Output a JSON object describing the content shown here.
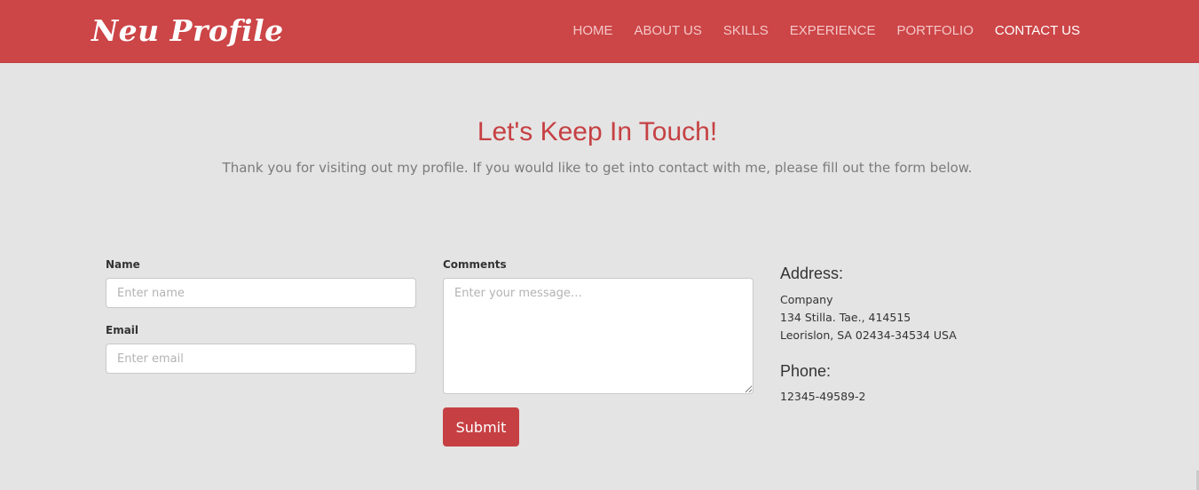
{
  "header": {
    "brand": "Neu Profile",
    "nav": [
      "HOME",
      "ABOUT US",
      "SKILLS",
      "EXPERIENCE",
      "PORTFOLIO",
      "CONTACT US"
    ],
    "active_item": "CONTACT US"
  },
  "hero": {
    "title": "Let's Keep In Touch!",
    "subtitle": "Thank you for visiting out my profile. If you would like to get into contact with me, please fill out the form below."
  },
  "form": {
    "name_label": "Name",
    "name_placeholder": "Enter name",
    "email_label": "Email",
    "email_placeholder": "Enter email",
    "comments_label": "Comments",
    "comments_placeholder": "Enter your message…",
    "submit_label": "Submit"
  },
  "contact": {
    "address_title": "Address:",
    "address_lines": [
      "Company",
      "134 Stilla. Tae., 414515",
      "Leorislon, SA 02434-34534 USA"
    ],
    "phone_title": "Phone:",
    "phone": "12345-49589-2"
  },
  "colors": {
    "navbar": "#cc4547",
    "accent": "#c64043",
    "background": "#e4e4e4"
  }
}
